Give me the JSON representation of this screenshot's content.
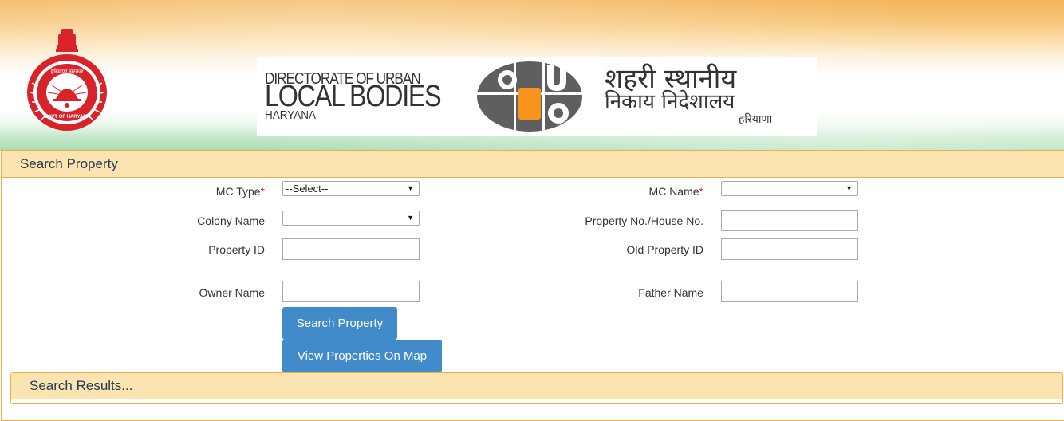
{
  "header": {
    "emblem_alt": "Govt of Haryana emblem",
    "emblem_text": "GOVT OF HARYANA",
    "org_name_en": {
      "line1": "DIRECTORATE OF URBAN",
      "line2": "LOCAL BODIES",
      "line3": "HARYANA"
    },
    "org_name_hi": {
      "line1": "शहरी स्थानीय",
      "line2": "निकाय निदेशालय",
      "line3": "हरियाणा"
    },
    "colors": {
      "saffron": "#f3b45a",
      "green": "#a8dcb2",
      "emblem_red": "#d9232b",
      "logo_grey": "#5f5f5f",
      "logo_orange": "#f7941d"
    }
  },
  "search_panel": {
    "title": "Search Property",
    "fields": {
      "mc_type": {
        "label": "MC Type",
        "required_mark": "*",
        "selected": "--Select--"
      },
      "mc_name": {
        "label": "MC Name",
        "required_mark": "*",
        "selected": ""
      },
      "colony_name": {
        "label": "Colony Name",
        "selected": ""
      },
      "property_no": {
        "label": "Property No./House No.",
        "value": ""
      },
      "property_id": {
        "label": "Property ID",
        "value": ""
      },
      "old_property_id": {
        "label": "Old Property ID",
        "value": ""
      },
      "owner_name": {
        "label": "Owner Name",
        "value": ""
      },
      "father_name": {
        "label": "Father Name",
        "value": ""
      }
    },
    "buttons": {
      "search": "Search Property",
      "view_map": "View Properties On Map"
    },
    "dropdown_arrow": "▼",
    "colors": {
      "heading_bg": "#fce4b0",
      "border": "#f0ad4e",
      "button_bg": "#428bca",
      "required": "#e02020"
    }
  },
  "results_panel": {
    "title": "Search Results..."
  }
}
